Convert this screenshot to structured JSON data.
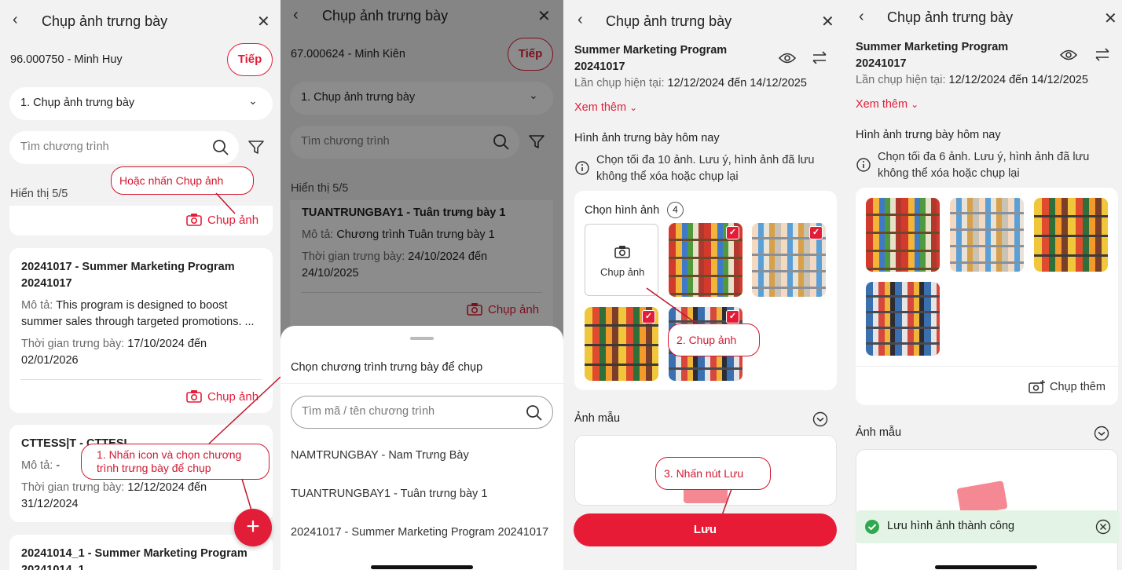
{
  "common": {
    "title": "Chụp ảnh trưng bày",
    "step_select": "1. Chụp ảnh trưng bày",
    "search_placeholder": "Tìm chương trình",
    "next_label": "Tiếp",
    "capture_label": "Chụp ảnh"
  },
  "panel1": {
    "user": "96.000750 - Minh Huy",
    "showing": "Hiển thị 5/5",
    "callout": "Hoặc nhấn Chụp ảnh",
    "card1": {
      "title_line1": "20241017 - Summer Marketing Program",
      "title_line2": "20241017",
      "desc_label": "Mô tả: ",
      "desc_line1": "This program is designed to boost",
      "desc_line2": "summer sales through targeted promotions. ...",
      "time_label": "Thời gian trưng bày: ",
      "time_line1": "17/10/2024 đến",
      "time_line2": "02/01/2026"
    },
    "card2": {
      "title": "CTTESS|T - CTTESI",
      "desc_label": "Mô tả: ",
      "desc": "-",
      "time_label": "Thời gian trưng bày: ",
      "time_line1": "12/12/2024 đến",
      "time_line2": "31/12/2024"
    },
    "card3": {
      "title_line1": "20241014_1 - Summer Marketing Program",
      "title_line2": "20241014_1"
    },
    "callout2_line1": "1. Nhấn icon và chọn chương",
    "callout2_line2": "trình trưng bày để chụp",
    "fab": "+"
  },
  "panel2": {
    "user": "67.000624 - Minh Kiên",
    "showing": "Hiển thị 5/5",
    "card": {
      "title": "TUANTRUNGBAY1 - Tuân trưng bày 1",
      "desc_label": "Mô tả: ",
      "desc": "Chương trình Tuân trưng bày 1",
      "time_label": "Thời gian trưng bày: ",
      "time_line1": "24/10/2024 đến",
      "time_line2": "24/10/2025"
    },
    "sheet": {
      "title": "Chọn chương trình trưng bày để chụp",
      "search_placeholder": "Tìm mã / tên chương trình",
      "items": [
        "NAMTRUNGBAY - Nam Trưng Bày",
        "TUANTRUNGBAY1 - Tuân trưng bày 1",
        "20241017 - Summer Marketing Program 20241017"
      ]
    }
  },
  "panel3": {
    "program_line1": "Summer Marketing Program",
    "program_line2": "20241017",
    "period_label": "Lần chụp hiện tại: ",
    "period": "12/12/2024 đến 14/12/2025",
    "see_more": "Xem thêm",
    "today_title": "Hình ảnh trưng bày hôm nay",
    "note_line1": "Chọn tối đa 10 ảnh. Lưu ý, hình ảnh đã lưu",
    "note_line2": "không thể xóa hoặc chụp lại",
    "pick_label": "Chọn hình ảnh",
    "pick_count": "4",
    "capture_tile": "Chụp ảnh",
    "callout_capture": "2. Chụp ảnh",
    "sample_label": "Ảnh mẫu",
    "callout_save": "3. Nhấn nút Lưu",
    "save_label": "Lưu"
  },
  "panel4": {
    "program_line1": "Summer Marketing Program",
    "program_line2": "20241017",
    "period_label": "Lần chụp hiện tại: ",
    "period": "12/12/2024 đến 14/12/2025",
    "see_more": "Xem thêm",
    "today_title": "Hình ảnh trưng bày hôm nay",
    "note_line1": "Chọn tối đa 6 ảnh. Lưu ý, hình ảnh đã lưu",
    "note_line2": "không thể xóa hoặc chụp lại",
    "capture_more": "Chụp thêm",
    "sample_label": "Ảnh mẫu",
    "toast": "Lưu hình ảnh thành công"
  },
  "colors": {
    "accent": "#e21d38",
    "success": "#2fa84f",
    "background": "#f2f2f2"
  }
}
